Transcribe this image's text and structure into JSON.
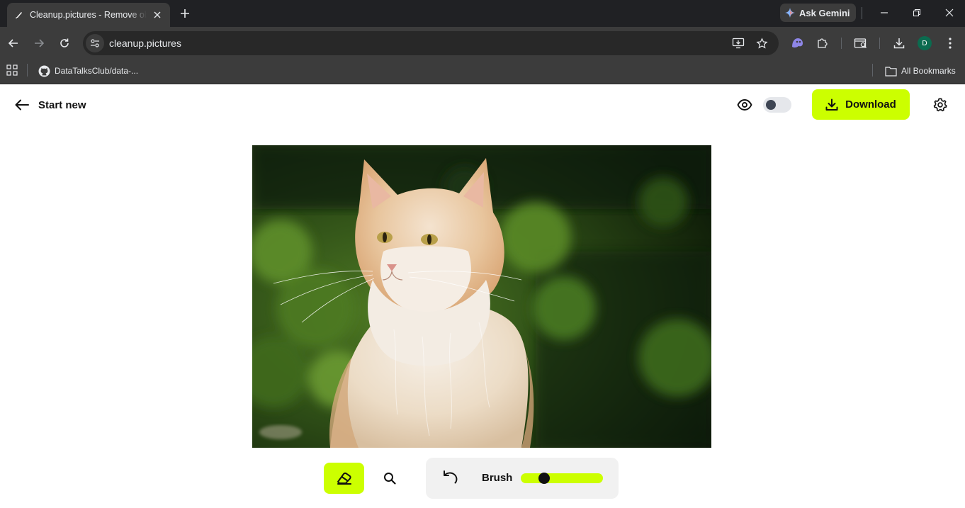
{
  "browser": {
    "tab_title": "Cleanup.pictures - Remove objects",
    "url": "cleanup.pictures",
    "gemini_label": "Ask Gemini",
    "profile_initial": "D",
    "bookmark_label": "DataTalksClub/data-...",
    "all_bookmarks_label": "All Bookmarks"
  },
  "app": {
    "start_new_label": "Start new",
    "download_label": "Download",
    "compare_toggle_on": false,
    "brush_label": "Brush",
    "brush_size": 0.25,
    "accent_color": "#ccff00"
  },
  "photo": {
    "alt": "Fluffy cream and white long-haired cat sitting in front of green foliage"
  }
}
